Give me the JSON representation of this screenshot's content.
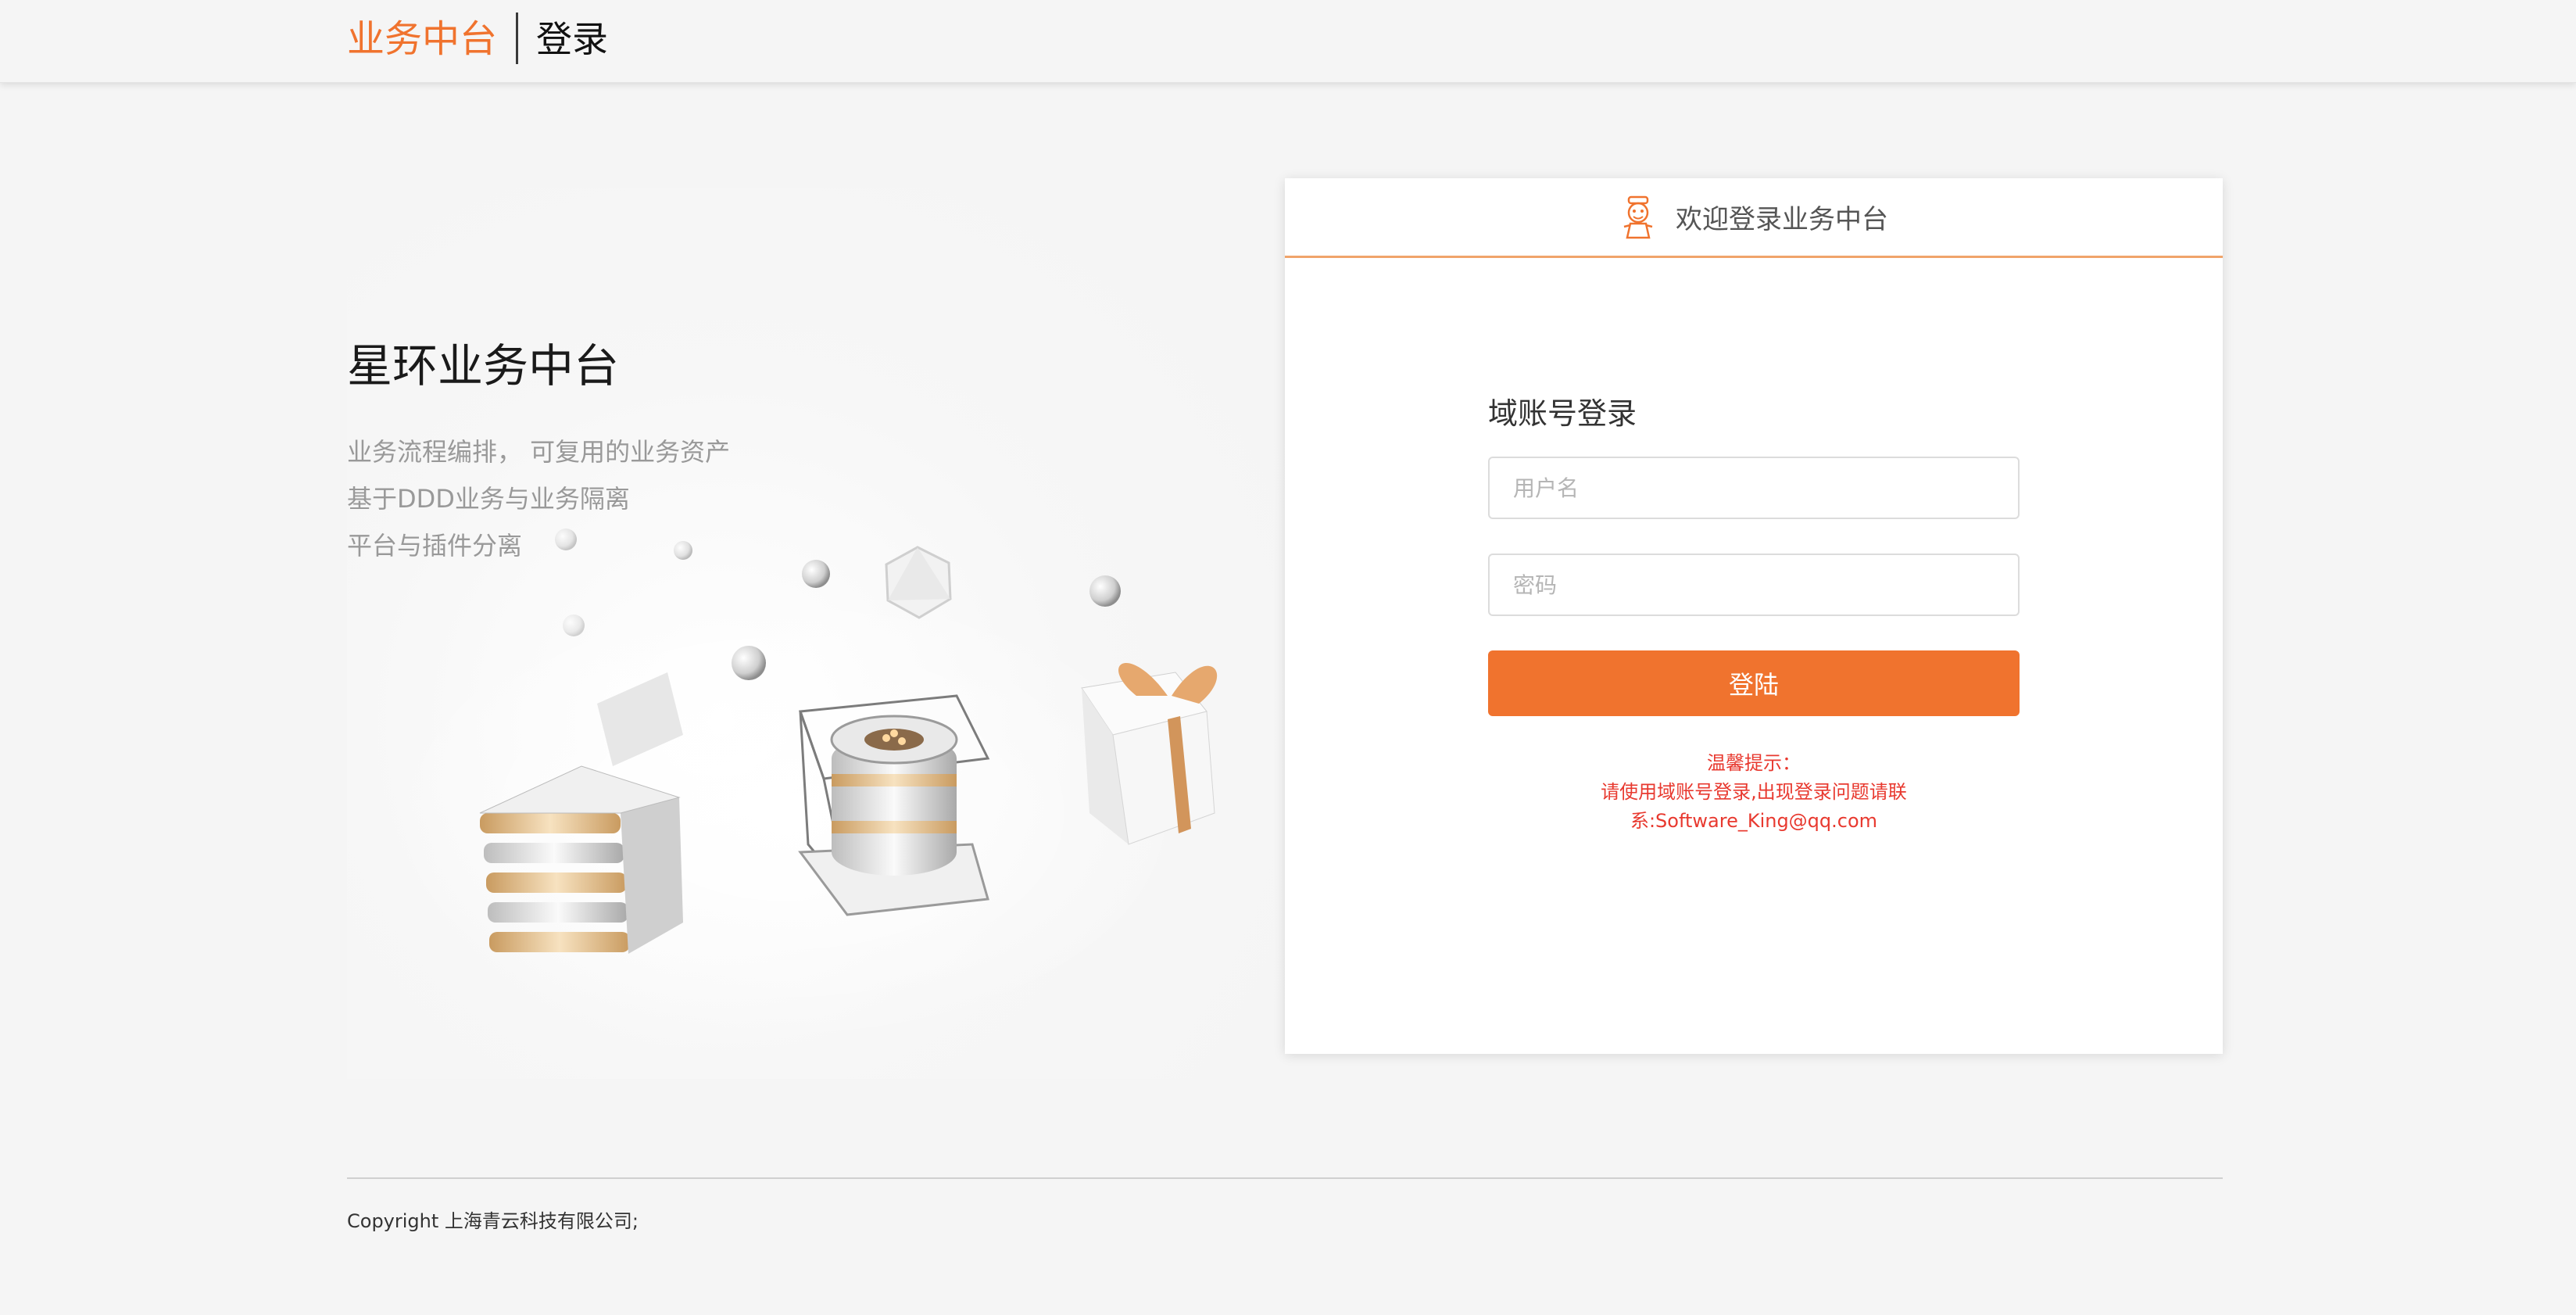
{
  "header": {
    "brand": "业务中台",
    "page_title": "登录"
  },
  "hero": {
    "title": "星环业务中台",
    "lines": [
      "业务流程编排， 可复用的业务资产",
      "基于DDD业务与业务隔离",
      "平台与插件分离"
    ]
  },
  "login_card": {
    "welcome": "欢迎登录业务中台",
    "form_title": "域账号登录",
    "username_placeholder": "用户名",
    "password_placeholder": "密码",
    "submit_label": "登陆",
    "tips": [
      "温馨提示：",
      "请使用域账号登录,出现登录问题请联",
      "系:Software_King@qq.com"
    ]
  },
  "footer": {
    "copyright": "Copyright 上海青云科技有限公司;"
  },
  "colors": {
    "accent": "#f0732e",
    "tip": "#e8392f"
  },
  "icons": {
    "welcome_icon": "mascot-icon"
  }
}
